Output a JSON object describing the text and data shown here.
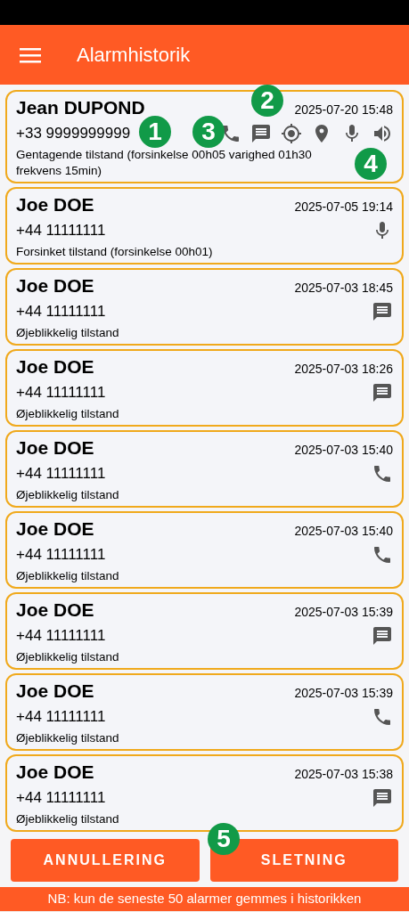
{
  "app_bar": {
    "title": "Alarmhistorik"
  },
  "alarms": [
    {
      "name": "Jean DUPOND",
      "phone": "+33 9999999999",
      "date": "2025-07-20 15:48",
      "description": "Gentagende tilstand (forsinkelse 00h05 varighed 01h30 frekvens 15min)",
      "icons": [
        {
          "kind": "phone"
        },
        {
          "kind": "message"
        },
        {
          "kind": "gps"
        },
        {
          "kind": "pin"
        },
        {
          "kind": "mic"
        },
        {
          "kind": "speaker"
        }
      ]
    },
    {
      "name": "Joe DOE",
      "phone": "+44 11111111",
      "date": "2025-07-05 19:14",
      "description": "Forsinket tilstand (forsinkelse 00h01)",
      "icons": [
        {
          "kind": "mic"
        }
      ]
    },
    {
      "name": "Joe DOE",
      "phone": "+44 11111111",
      "date": "2025-07-03 18:45",
      "description": "Øjeblikkelig tilstand",
      "icons": [
        {
          "kind": "message"
        }
      ]
    },
    {
      "name": "Joe DOE",
      "phone": "+44 11111111",
      "date": "2025-07-03 18:26",
      "description": "Øjeblikkelig tilstand",
      "icons": [
        {
          "kind": "message"
        }
      ]
    },
    {
      "name": "Joe DOE",
      "phone": "+44 11111111",
      "date": "2025-07-03 15:40",
      "description": "Øjeblikkelig tilstand",
      "icons": [
        {
          "kind": "phone"
        }
      ]
    },
    {
      "name": "Joe DOE",
      "phone": "+44 11111111",
      "date": "2025-07-03 15:40",
      "description": "Øjeblikkelig tilstand",
      "icons": [
        {
          "kind": "phone"
        }
      ]
    },
    {
      "name": "Joe DOE",
      "phone": "+44 11111111",
      "date": "2025-07-03 15:39",
      "description": "Øjeblikkelig tilstand",
      "icons": [
        {
          "kind": "message"
        }
      ]
    },
    {
      "name": "Joe DOE",
      "phone": "+44 11111111",
      "date": "2025-07-03 15:39",
      "description": "Øjeblikkelig tilstand",
      "icons": [
        {
          "kind": "phone"
        }
      ]
    },
    {
      "name": "Joe DOE",
      "phone": "+44 11111111",
      "date": "2025-07-03 15:38",
      "description": "Øjeblikkelig tilstand",
      "icons": [
        {
          "kind": "message"
        }
      ]
    }
  ],
  "callouts": [
    "1",
    "2",
    "3",
    "4",
    "5"
  ],
  "buttons": [
    "ANNULLERING",
    "SLETNING"
  ],
  "footer_note": "NB: kun de seneste 50 alarmer gemmes i historikken"
}
